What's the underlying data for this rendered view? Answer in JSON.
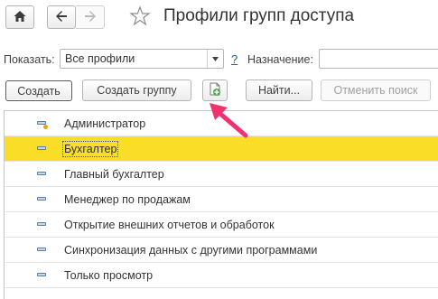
{
  "toolbar": {
    "home_icon": "home-icon",
    "back_icon": "arrow-left-icon",
    "forward_icon": "arrow-right-icon",
    "favorite_icon": "star-icon",
    "title": "Профили групп доступа"
  },
  "filters": {
    "show_label": "Показать:",
    "show_value": "Все профили",
    "help_link": "?",
    "purpose_label": "Назначение:",
    "purpose_value": ""
  },
  "actions": {
    "create": "Создать",
    "create_group": "Создать группу",
    "copy_icon": "copy-add-icon",
    "find": "Найти...",
    "cancel_search": "Отменить поиск"
  },
  "rows": [
    {
      "label": "Администратор",
      "icon": "profile-admin-icon",
      "selected": false
    },
    {
      "label": "Бухгалтер",
      "icon": "profile-icon",
      "selected": true
    },
    {
      "label": "Главный бухгалтер",
      "icon": "profile-icon",
      "selected": false
    },
    {
      "label": "Менеджер по продажам",
      "icon": "profile-icon",
      "selected": false
    },
    {
      "label": "Открытие внешних отчетов и обработок",
      "icon": "profile-icon",
      "selected": false
    },
    {
      "label": "Синхронизация данных с другими программами",
      "icon": "profile-icon",
      "selected": false
    },
    {
      "label": "Только просмотр",
      "icon": "profile-icon",
      "selected": false
    }
  ],
  "colors": {
    "selected_row": "#f9dd27",
    "annotation_arrow": "#f0326e"
  }
}
